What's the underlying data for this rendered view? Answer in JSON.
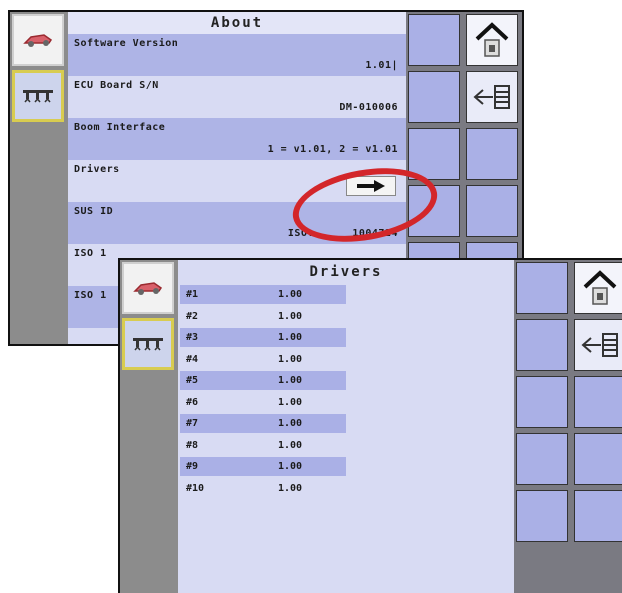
{
  "about_screen": {
    "title": "About",
    "rows": [
      {
        "label": "Software Version",
        "value": "1.01|"
      },
      {
        "label": "ECU Board S/N",
        "value": "DM-010006"
      },
      {
        "label": "Boom Interface",
        "value": "1 = v1.01, 2 = v1.01"
      },
      {
        "label": "Drivers",
        "value": ""
      },
      {
        "label": "SUS ID",
        "prefix": "ISO:",
        "value": "1004724"
      },
      {
        "label": "ISO 1",
        "value": ""
      },
      {
        "label": "ISO 1",
        "value": ""
      }
    ],
    "drivers_button_icon": "right-arrow-icon"
  },
  "drivers_screen": {
    "title": "Drivers",
    "rows": [
      {
        "num": "#1",
        "ver": "1.00"
      },
      {
        "num": "#2",
        "ver": "1.00"
      },
      {
        "num": "#3",
        "ver": "1.00"
      },
      {
        "num": "#4",
        "ver": "1.00"
      },
      {
        "num": "#5",
        "ver": "1.00"
      },
      {
        "num": "#6",
        "ver": "1.00"
      },
      {
        "num": "#7",
        "ver": "1.00"
      },
      {
        "num": "#8",
        "ver": "1.00"
      },
      {
        "num": "#9",
        "ver": "1.00"
      },
      {
        "num": "#10",
        "ver": "1.00"
      }
    ]
  },
  "icons": {
    "machine_tab": "sprayer-vehicle-icon",
    "boom_tab": "boom-nozzles-icon",
    "home": "home-icon",
    "back": "back-list-icon"
  },
  "colors": {
    "highlight_ellipse": "#d3262a",
    "row_shade": "#aab0e6",
    "panel_bg": "#d8dbf3",
    "selected_tab_border": "#d8cc50"
  }
}
